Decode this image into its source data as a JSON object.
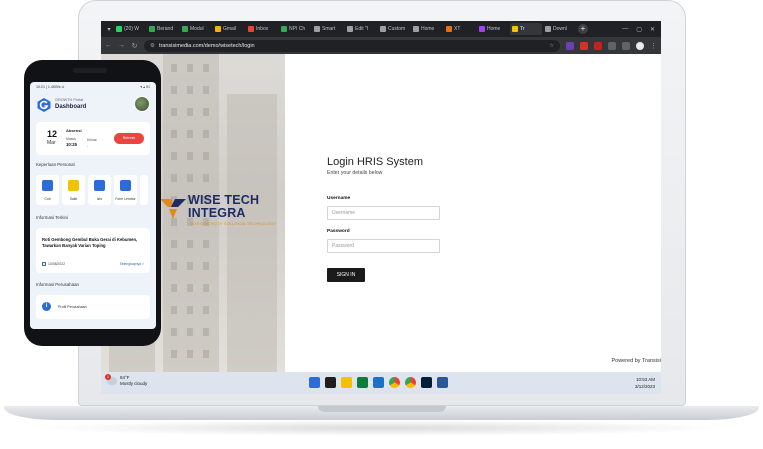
{
  "browser": {
    "tabs": [
      {
        "label": "(20) W",
        "color": "#25d366"
      },
      {
        "label": "Berand",
        "color": "#34a853"
      },
      {
        "label": "Modul",
        "color": "#34a853"
      },
      {
        "label": "Gmail",
        "color": "#f4b400"
      },
      {
        "label": "Inbox",
        "color": "#ea4335"
      },
      {
        "label": "NPI Ch",
        "color": "#34a853"
      },
      {
        "label": "Smart",
        "color": "#9aa0a6"
      },
      {
        "label": "Edit \"I",
        "color": "#9aa0a6"
      },
      {
        "label": "Custom",
        "color": "#9aa0a6"
      },
      {
        "label": "Home",
        "color": "#9aa0a6"
      },
      {
        "label": "XT",
        "color": "#e8710a"
      },
      {
        "label": "Home",
        "color": "#a142f4"
      },
      {
        "label": "Tr",
        "color": "#f5c400",
        "active": true
      },
      {
        "label": "Downl",
        "color": "#9aa0a6"
      }
    ],
    "url": "transisimedia.com/demo/wisetech/login"
  },
  "brand": {
    "name_line1": "WISE TECH",
    "name_line2": "INTEGRA",
    "tagline": "INTEGRATED IT SOLUTION TECHNOLOGY",
    "colors": {
      "navy": "#1e2c66",
      "orange": "#e08a1c"
    }
  },
  "login": {
    "title": "Login HRIS System",
    "subtitle": "Enter your details below",
    "username_label": "Username",
    "username_placeholder": "Username",
    "password_label": "Password",
    "password_placeholder": "Password",
    "submit_label": "SIGN IN",
    "powered_by": "Powered by Transisi"
  },
  "taskbar": {
    "weather_temp": "84°F",
    "weather_desc": "Mostly cloudy",
    "weather_badge": "1",
    "time": "10:53 AM",
    "date": "3/12/2023"
  },
  "phone": {
    "status_left": "10:21 | 1.4KB/s ⊙",
    "status_right": "▾ ▴ 91",
    "app_name": "GROWTH Portal",
    "screen_title": "Dashboard",
    "attendance": {
      "day": "12",
      "month": "Mar",
      "status": "Absensi",
      "in_label": "Masuk",
      "in_time": "10:25",
      "out_label": "Keluar",
      "out_time": "-",
      "button": "Refresh"
    },
    "personal_heading": "Keperluan Personal",
    "menu": [
      {
        "label": "Cuti",
        "icon": "calendar-icon",
        "color": "#2d6bd8"
      },
      {
        "label": "Sakit",
        "icon": "ambulance-icon",
        "color": "#f2c200"
      },
      {
        "label": "Izin",
        "icon": "info-icon",
        "color": "#2d6bd8"
      },
      {
        "label": "Form Lembur",
        "icon": "form-icon",
        "color": "#2d6bd8"
      }
    ],
    "news_heading": "Informasi Terkini",
    "news": {
      "title": "Roti Gembong Gembul Buka Gerai di Kebumen, Tawarkan Banyak Varian Toping",
      "date": "10/08/2022",
      "more": "Selengkapnya >"
    },
    "company_heading": "Informasi Perusahaan",
    "company_item": "Profil Perusahaan"
  }
}
